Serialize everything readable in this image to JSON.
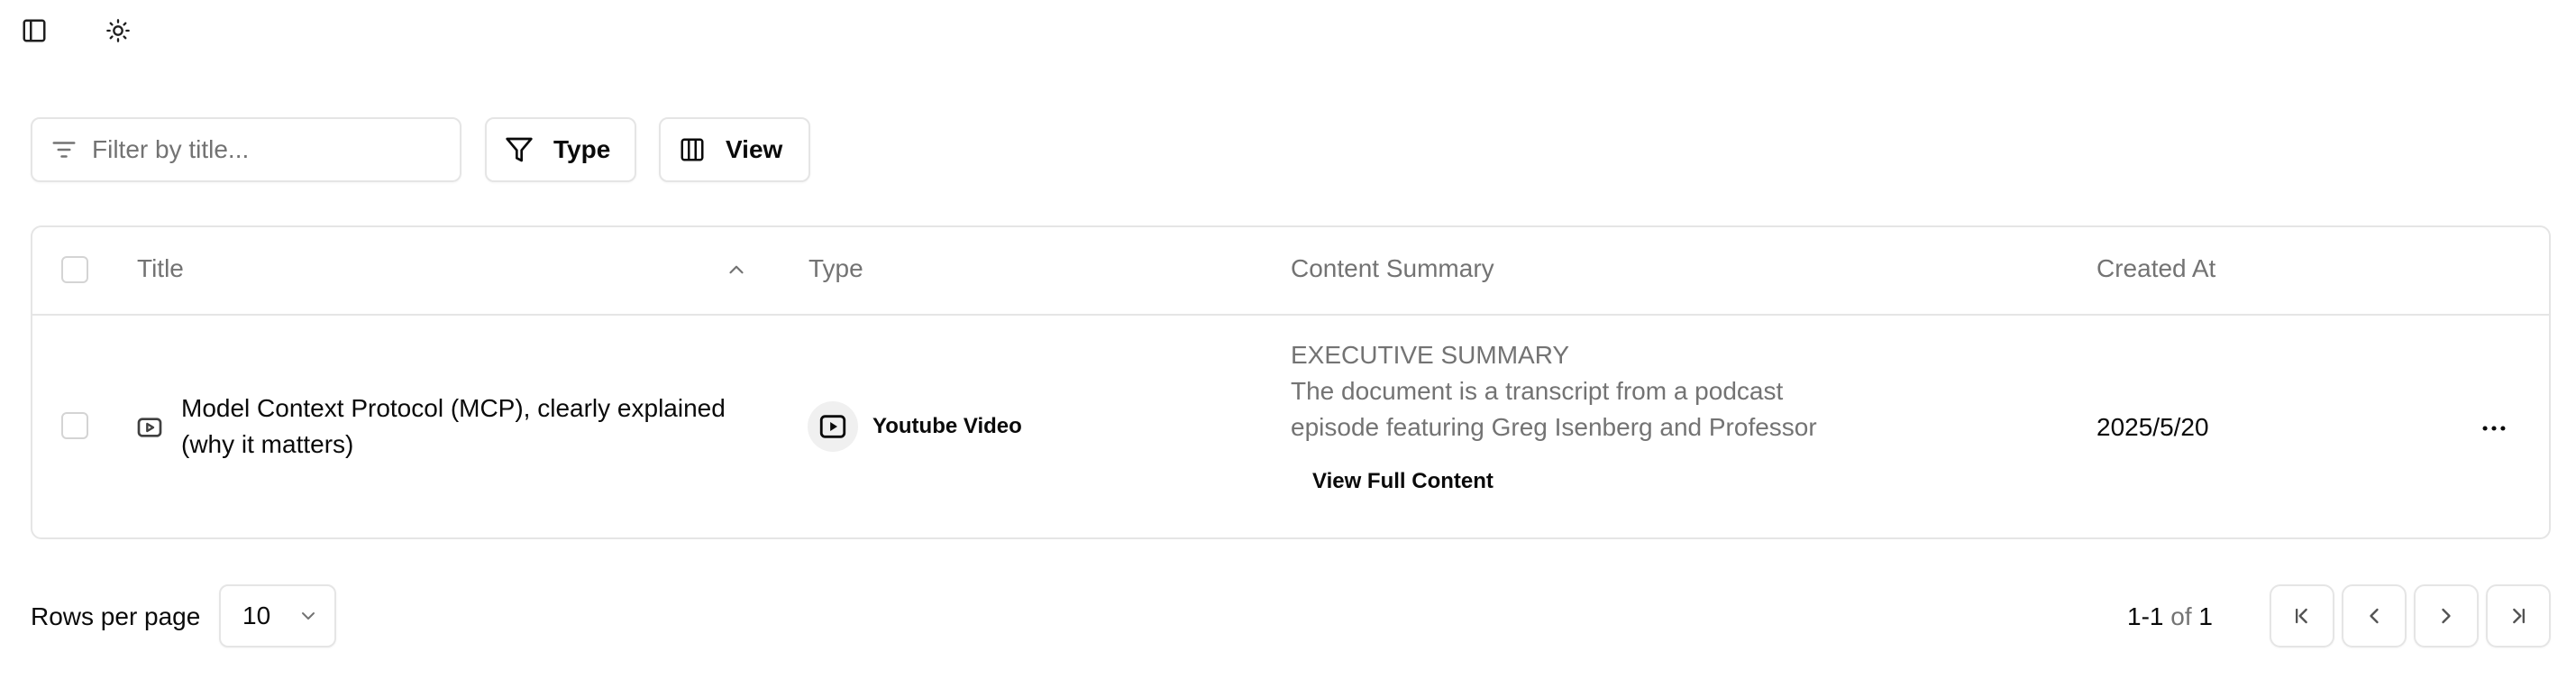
{
  "toolbar": {
    "filter_placeholder": "Filter by title...",
    "type_button": "Type",
    "view_button": "View"
  },
  "table": {
    "columns": [
      "Title",
      "Type",
      "Content Summary",
      "Created At"
    ],
    "rows": [
      {
        "title_line1": "Model Context Protocol (MCP), clearly explained",
        "title_line2": "(why it matters)",
        "type": "Youtube Video",
        "summary_heading": "EXECUTIVE SUMMARY",
        "summary_line1": "The document is a transcript from a podcast",
        "summary_line2": "episode featuring Greg Isenberg and Professor",
        "view_full": "View Full Content",
        "created_at": "2025/5/20"
      }
    ]
  },
  "pagination": {
    "rows_per_page_label": "Rows per page",
    "rows_per_page_value": "10",
    "range": "1-1",
    "of_label": "of",
    "total": "1"
  },
  "icons": {
    "sidebar": "panel-left-icon",
    "theme": "sun-icon",
    "filter": "filter-lines-icon",
    "funnel": "funnel-icon",
    "columns": "columns-icon",
    "sort": "chevron-up-icon",
    "row_type": "youtube-icon",
    "more": "ellipsis-icon"
  }
}
